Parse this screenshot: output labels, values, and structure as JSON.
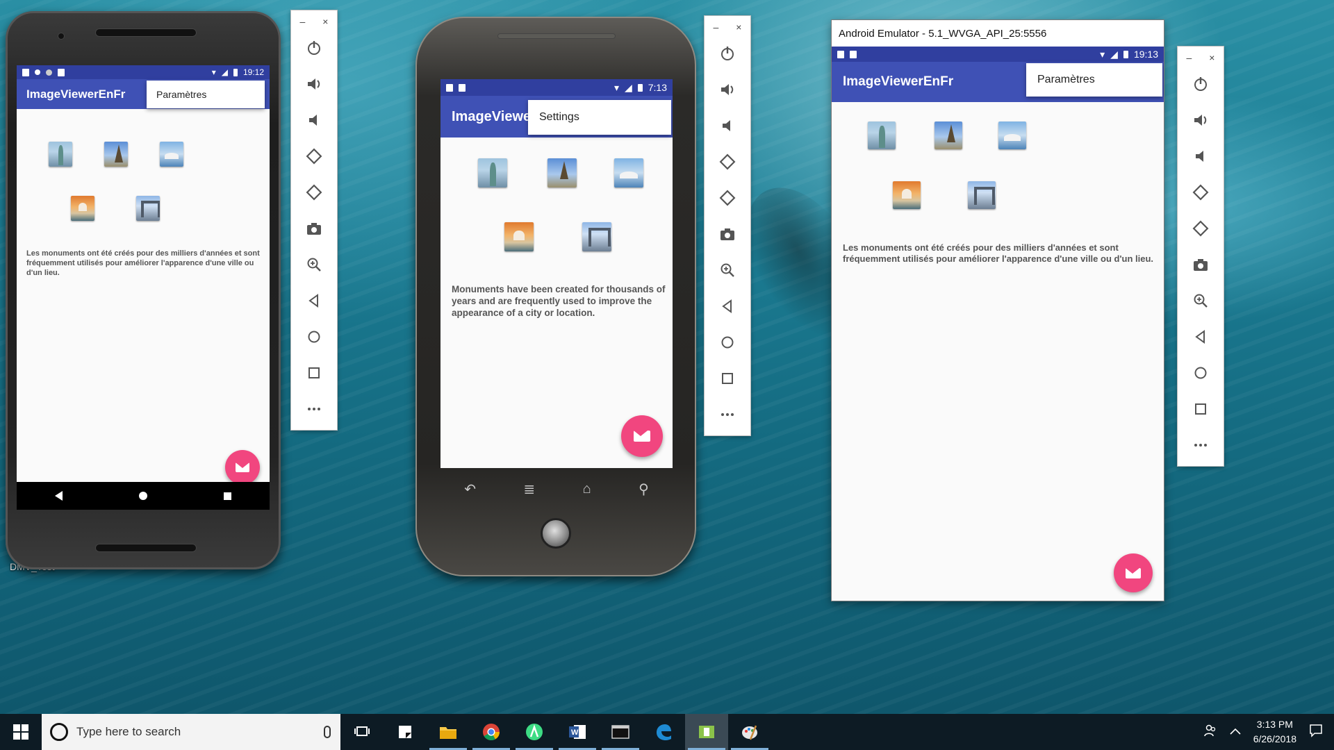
{
  "desktop": {
    "shortcut_label": "DMV_Test"
  },
  "phone1": {
    "status_time": "19:12",
    "app_title": "ImageViewerEnFr",
    "menu_item": "Paramètres",
    "description": "Les monuments ont été créés pour des milliers d'années et sont fréquemment utilisés pour améliorer l'apparence d'une ville ou d'un lieu."
  },
  "phone2": {
    "status_time": "7:13",
    "app_title": "ImageViewe",
    "menu_item": "Settings",
    "description": "Monuments have been created for thousands of years and are frequently used to improve the appearance of a city or location."
  },
  "window3": {
    "title": "Android Emulator - 5.1_WVGA_API_25:5556",
    "status_time": "19:13",
    "app_title": "ImageViewerEnFr",
    "menu_item": "Paramètres",
    "description": "Les monuments ont été créés pour des milliers d'années et sont fréquemment utilisés pour améliorer l'apparence d'une ville ou d'un lieu."
  },
  "emulator_toolbar": {
    "minimize": "–",
    "close": "×",
    "tools": [
      "power-icon",
      "volume-up-icon",
      "volume-down-icon",
      "rotate-left-icon",
      "rotate-right-icon",
      "camera-icon",
      "zoom-icon",
      "back-icon",
      "home-icon",
      "overview-icon",
      "more-icon"
    ]
  },
  "thumbnails": [
    "statue-of-liberty",
    "eiffel-tower",
    "sydney-opera-house",
    "taj-mahal",
    "tower-bridge"
  ],
  "taskbar": {
    "search_placeholder": "Type here to search",
    "clock_time": "3:13 PM",
    "clock_date": "6/26/2018",
    "apps": [
      "task-view-icon",
      "sticky-notes-icon",
      "file-explorer-icon",
      "chrome-icon",
      "android-studio-icon",
      "word-icon",
      "terminal-icon",
      "edge-icon",
      "emulator-icon",
      "paint-icon"
    ]
  },
  "colors": {
    "primary": "#3f51b5",
    "primary_dark": "#303f9f",
    "accent": "#f1467f",
    "taskbar": "#0d1b24"
  }
}
